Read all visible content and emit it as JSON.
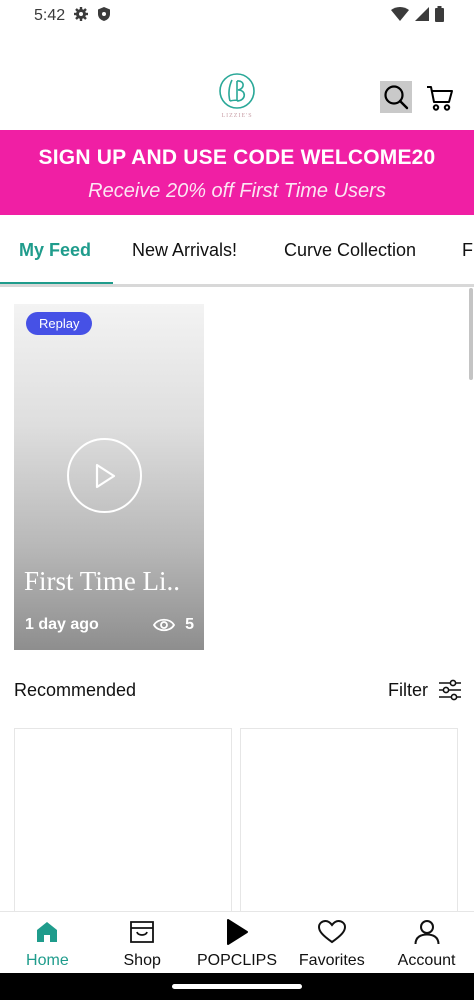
{
  "status_bar": {
    "time": "5:42"
  },
  "header": {
    "logo_text": "LIZZIE'S",
    "logo_monogram": "LB"
  },
  "promo": {
    "title": "SIGN UP AND USE CODE WELCOME20",
    "subtitle": "Receive 20% off First Time Users",
    "background": "#f01fa4"
  },
  "tabs": [
    {
      "label": "My Feed",
      "active": true
    },
    {
      "label": "New Arrivals!"
    },
    {
      "label": "Curve Collection"
    },
    {
      "label": "F"
    }
  ],
  "video": {
    "badge": "Replay",
    "title": "First Time Li..",
    "time_ago": "1 day ago",
    "views": "5"
  },
  "recommended": {
    "title": "Recommended",
    "filter_label": "Filter"
  },
  "bottom_nav": [
    {
      "label": "Home",
      "icon": "home-icon",
      "active": true
    },
    {
      "label": "Shop",
      "icon": "shop-icon"
    },
    {
      "label": "POPCLIPS",
      "icon": "play-icon"
    },
    {
      "label": "Favorites",
      "icon": "heart-icon"
    },
    {
      "label": "Account",
      "icon": "account-icon"
    }
  ],
  "colors": {
    "accent": "#1f9c8c",
    "badge": "#4651e6"
  }
}
